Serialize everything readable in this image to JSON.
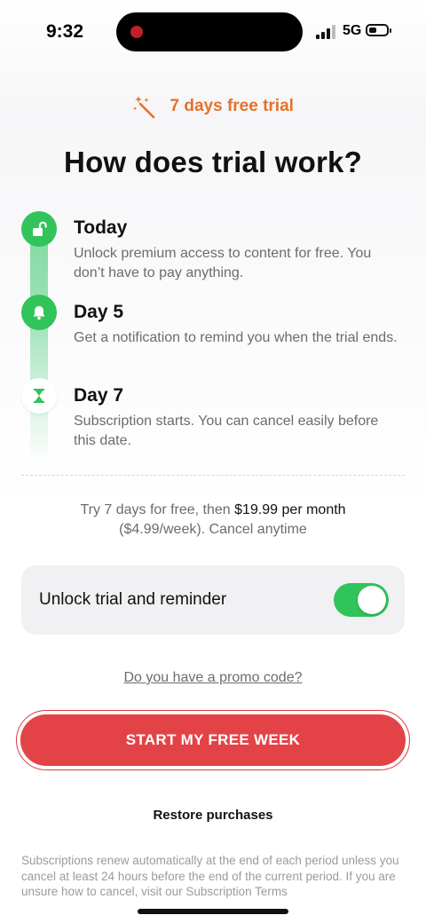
{
  "status_bar": {
    "time": "9:32",
    "network": "5G"
  },
  "badge": {
    "icon": "magic-wand-icon",
    "text": "7 days free trial",
    "color": "#e5722a"
  },
  "title": "How does trial work?",
  "timeline": [
    {
      "icon": "unlock-icon",
      "title": "Today",
      "description": "Unlock premium access to content for free. You don’t have to pay anything."
    },
    {
      "icon": "bell-icon",
      "title": "Day 5",
      "description": "Get a notification to remind you when the trial ends."
    },
    {
      "icon": "hourglass-icon",
      "title": "Day 7",
      "description": "Subscription starts. You can cancel easily before this date."
    }
  ],
  "pricing": {
    "prefix": "Try 7 days for free, then ",
    "price": "$19.99 per month",
    "suffix": "($4.99/week). Cancel anytime"
  },
  "toggle": {
    "label": "Unlock trial and reminder",
    "on": true
  },
  "promo_link": "Do you have a promo code?",
  "cta": "START MY FREE WEEK",
  "restore": "Restore purchases",
  "legal": {
    "text": "Subscriptions renew automatically at the end of each period unless you cancel at least 24 hours before the end of the current period. If you are unsure how to cancel, visit our ",
    "link": "Subscription Terms"
  },
  "colors": {
    "accent_green": "#31c45a",
    "cta_red": "#e34347",
    "badge_orange": "#e5722a"
  }
}
